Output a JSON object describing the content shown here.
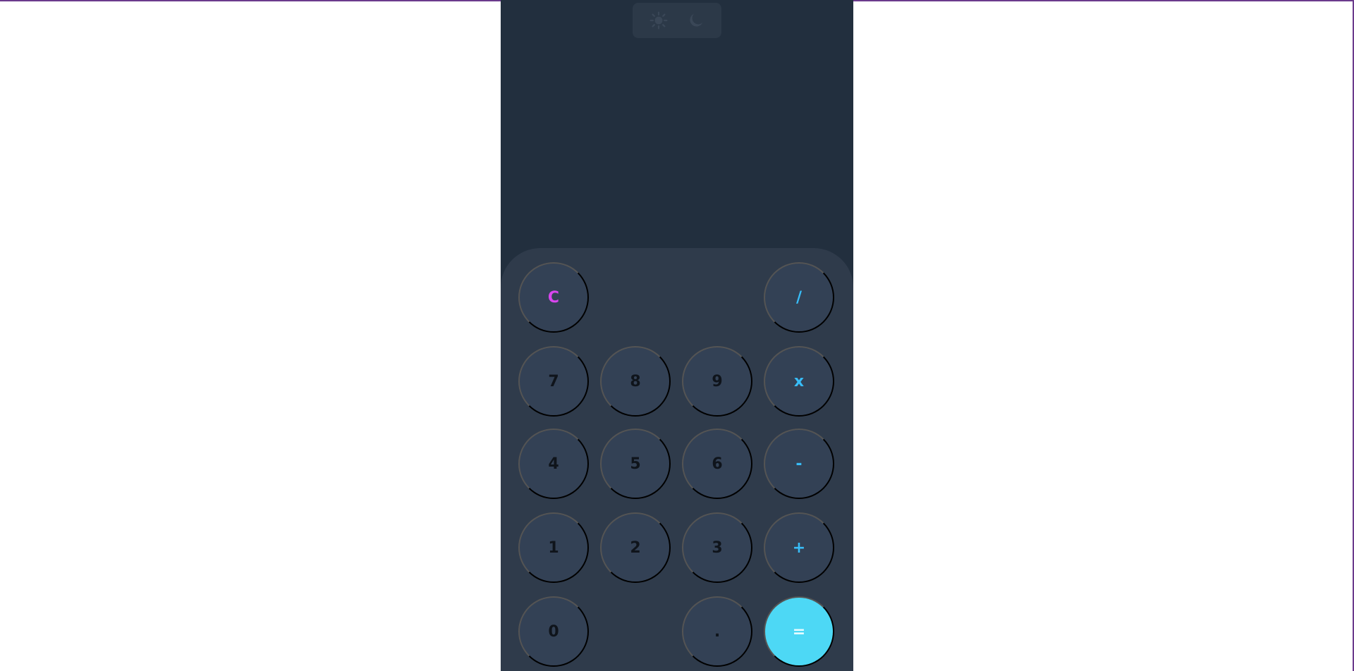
{
  "colors": {
    "page_background": "#ffffff",
    "calculator_background": "#222f3e",
    "keypad_background": "#2f3b4b",
    "key_background": "#334155",
    "equals_background": "#4dd8f5",
    "operator_color": "#38bdf8",
    "clear_color": "#d946ef",
    "border_accent": "#6b3a8c"
  },
  "theme_toggle": {
    "icons": [
      "sun-icon",
      "moon-icon"
    ]
  },
  "display": {
    "value": ""
  },
  "keys": {
    "clear": "C",
    "divide": "/",
    "seven": "7",
    "eight": "8",
    "nine": "9",
    "multiply": "x",
    "four": "4",
    "five": "5",
    "six": "6",
    "subtract": "-",
    "one": "1",
    "two": "2",
    "three": "3",
    "add": "+",
    "zero": "0",
    "decimal": ".",
    "equals": "="
  }
}
